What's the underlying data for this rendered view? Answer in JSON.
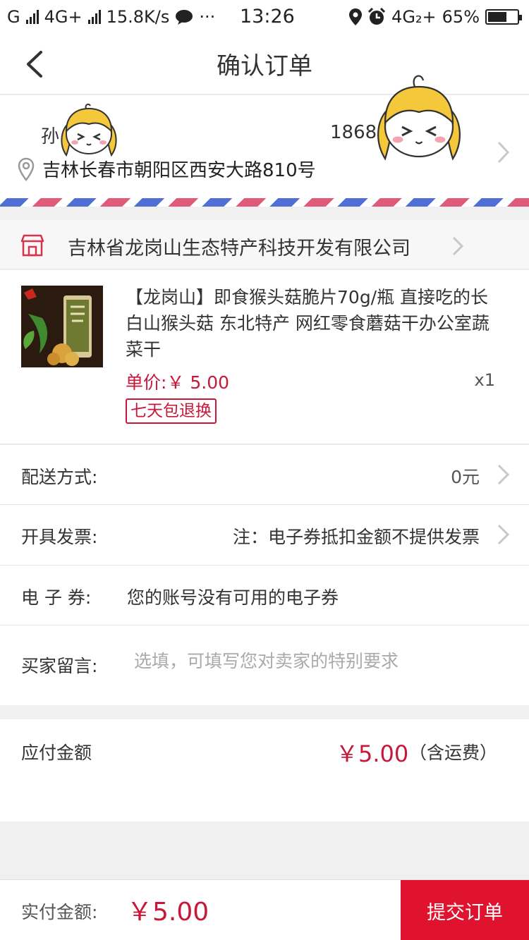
{
  "status_bar": {
    "carrier": "G",
    "network1": "4G+",
    "speed": "15.8K/s",
    "more": "···",
    "time": "13:26",
    "network2": "4G₂+",
    "battery": "65%",
    "battery_level": 0.65
  },
  "nav": {
    "title": "确认订单"
  },
  "address": {
    "name": "孙",
    "phone": "1868",
    "text": "吉林长春市朝阳区西安大路810号"
  },
  "shop": {
    "name": "吉林省龙岗山生态特产科技开发有限公司"
  },
  "product": {
    "title": "【龙岗山】即食猴头菇脆片70g/瓶 直接吃的长白山猴头菇 东北特产 网红零食蘑菇干办公室蔬菜干",
    "price": "单价:￥ 5.00",
    "quantity": "x1",
    "badge": "七天包退换"
  },
  "delivery": {
    "label": "配送方式:",
    "value": "0元"
  },
  "invoice": {
    "label": "开具发票:",
    "value": "注：电子券抵扣金额不提供发票"
  },
  "coupon": {
    "label": "电 子 券:",
    "value": "您的账号没有可用的电子券"
  },
  "message": {
    "label": "买家留言:",
    "placeholder": "选填，可填写您对卖家的特别要求",
    "value": ""
  },
  "payable": {
    "label": "应付金额",
    "amount": "￥5.00",
    "note": "（含运费）"
  },
  "bottom": {
    "label": "实付金额:",
    "total": "￥5.00",
    "submit": "提交订单"
  },
  "colors": {
    "accent": "#e0132e",
    "price": "#c8183a",
    "airmail_red": "#e05b7a",
    "airmail_blue": "#4f6fd6"
  },
  "icons": [
    "back-chevron-icon",
    "location-pin-icon",
    "shop-icon",
    "chevron-right-icon",
    "signal-icon",
    "wechat-icon",
    "location-icon",
    "alarm-icon",
    "battery-icon"
  ]
}
